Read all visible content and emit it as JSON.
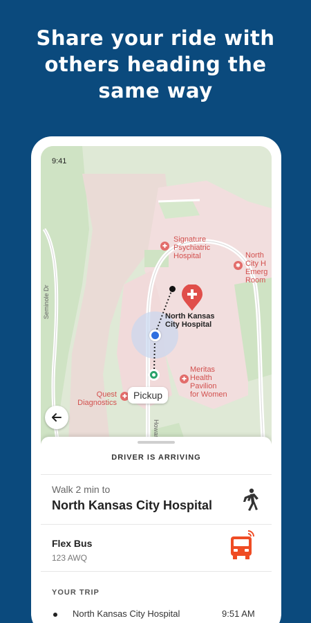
{
  "headline": {
    "line1": "Share your ride with",
    "line2": "others heading the",
    "line3": "same way"
  },
  "status_bar": {
    "time": "9:41"
  },
  "map": {
    "labels": {
      "signature": [
        "Signature",
        "Psychiatric",
        "Hospital"
      ],
      "nkc_emergency": [
        "North",
        "City H",
        "Emerg",
        "Room"
      ],
      "nkc_hospital": [
        "North Kansas",
        "City Hospital"
      ],
      "meritas": [
        "Meritas",
        "Health",
        "Pavilion",
        "for Women"
      ],
      "quest": [
        "Quest",
        "Diagnostics"
      ],
      "street_seminole": "Seminole Dr",
      "street_howard": "Howard St"
    },
    "pickup_label": "Pickup",
    "colors": {
      "route_blue": "#2f6fe0",
      "pickup_green": "#2ba36b",
      "hospital_red": "#e04e4a"
    }
  },
  "sheet": {
    "title": "DRIVER IS ARRIVING",
    "walk": {
      "subtitle": "Walk 2 min to",
      "destination": "North Kansas City Hospital"
    },
    "bus": {
      "name": "Flex Bus",
      "code": "123 AWQ",
      "color": "#ef4c24"
    },
    "trip": {
      "title": "YOUR TRIP",
      "stops": [
        {
          "name": "North Kansas City Hospital",
          "time": "9:51 AM"
        }
      ]
    }
  }
}
